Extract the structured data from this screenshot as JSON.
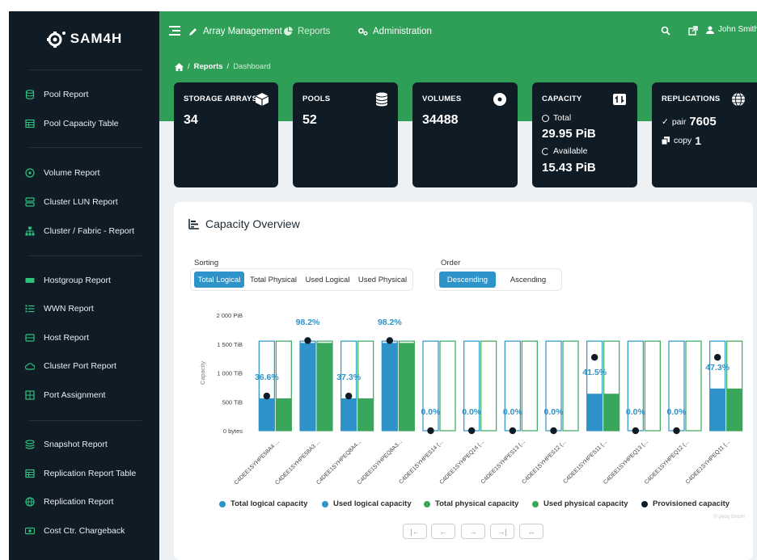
{
  "app": {
    "logo_text": "SAM4H"
  },
  "sidebar": {
    "items": [
      {
        "label": "Pool Report",
        "icon": "database-icon"
      },
      {
        "label": "Pool Capacity Table",
        "icon": "table-icon"
      },
      {
        "label": "Volume Report",
        "icon": "disc-icon"
      },
      {
        "label": "Cluster LUN Report",
        "icon": "server-icon"
      },
      {
        "label": "Cluster / Fabric - Report",
        "icon": "sitemap-icon"
      },
      {
        "label": "Hostgroup Report",
        "icon": "hdd-icon"
      },
      {
        "label": "WWN Report",
        "icon": "list-icon"
      },
      {
        "label": "Host Report",
        "icon": "host-icon"
      },
      {
        "label": "Cluster Port Report",
        "icon": "cloud-icon"
      },
      {
        "label": "Port Assignment",
        "icon": "grid-icon"
      },
      {
        "label": "Snapshot Report",
        "icon": "layers-icon"
      },
      {
        "label": "Replication Report Table",
        "icon": "table-icon"
      },
      {
        "label": "Replication Report",
        "icon": "globe-icon"
      },
      {
        "label": "Cost Ctr. Chargeback",
        "icon": "money-icon"
      }
    ]
  },
  "header": {
    "nav": [
      {
        "label": "Array Management",
        "icon": "pencil-icon"
      },
      {
        "label": "Reports",
        "icon": "pie-chart-icon"
      },
      {
        "label": "Administration",
        "icon": "cogs-icon"
      }
    ],
    "user": "John Smith"
  },
  "breadcrumb": {
    "items": [
      "Reports",
      "Dashboard"
    ]
  },
  "cards": {
    "storage_arrays": {
      "title": "STORAGE ARRAYS",
      "value": "34",
      "icon": "cube-icon"
    },
    "pools": {
      "title": "POOLS",
      "value": "52",
      "icon": "database-icon"
    },
    "volumes": {
      "title": "VOLUMES",
      "value": "34488",
      "icon": "disc-icon"
    },
    "capacity": {
      "title": "CAPACITY",
      "total_label": "Total",
      "total_value": "29.95 PiB",
      "available_label": "Available",
      "available_value": "15.43 PiB",
      "icon": "transfer-icon"
    },
    "replications": {
      "title": "REPLICATIONS",
      "pair_label": "pair",
      "pair_value": "7605",
      "copy_label": "copy",
      "copy_value": "1",
      "icon": "globe-icon"
    }
  },
  "panel": {
    "title": "Capacity Overview",
    "sorting": {
      "label": "Sorting",
      "options": [
        "Total Logical",
        "Total Physical",
        "Used Logical",
        "Used Physical"
      ],
      "selected": "Total Logical"
    },
    "order": {
      "label": "Order",
      "options": [
        "Descending",
        "Ascending"
      ],
      "selected": "Descending"
    },
    "legend": [
      {
        "label": "Total logical capacity",
        "color": "#2d93c8"
      },
      {
        "label": "Used logical capacity",
        "color": "#2d93c8"
      },
      {
        "label": "Total physical capacity",
        "color": "#3aa65c"
      },
      {
        "label": "Used physical capacity",
        "color": "#3aa65c"
      },
      {
        "label": "Provisioned capacity",
        "color": "#0f1b25"
      }
    ],
    "pager": [
      "|←",
      "←",
      "→",
      "→|",
      "↔"
    ],
    "credit": "© peoq GmbH"
  },
  "colors": {
    "sidebar_bg": "#0f1b25",
    "header_bg": "#2f9e56",
    "logical": "#2d93c8",
    "physical": "#3aa65c",
    "provisioned": "#0f1b25"
  },
  "chart_data": {
    "type": "bar",
    "ylabel": "Capacity",
    "ytick_labels": [
      "0 bytes",
      "500 TiB",
      "1 000 TiB",
      "1 500 TiB",
      "2 000 PiB"
    ],
    "ytick_values": [
      0,
      500,
      1000,
      1500,
      2000
    ],
    "ylim": [
      0,
      2000
    ],
    "categories": [
      "C4DEE1SYHPE58A4 ...",
      "C4DEE1SYHPE58A3 ...",
      "C4DEE1SYHPEQ8A4...",
      "C4DEE1SYHPEQ8A3...",
      "C4DEE1SYHPES14 (...",
      "C4DEE1SYHPEQ14 (...",
      "C4DEE1SYHPES13 (...",
      "C4DEE1SYHPES12 (...",
      "C4DEE1SYHPES11 (...",
      "C4DEE1SYHPEQ13 (...",
      "C4DEE1SYHPEQ12 (...",
      "C4DEE1SYHPEQ11 (..."
    ],
    "series": [
      {
        "name": "Total logical capacity",
        "values": [
          1550,
          1550,
          1550,
          1550,
          1550,
          1550,
          1550,
          1550,
          1550,
          1550,
          1550,
          1550
        ]
      },
      {
        "name": "Used logical capacity",
        "values": [
          560,
          1520,
          560,
          1520,
          0,
          0,
          0,
          0,
          640,
          0,
          0,
          730
        ]
      },
      {
        "name": "Total physical capacity",
        "values": [
          1550,
          1550,
          1550,
          1550,
          1550,
          1550,
          1550,
          1550,
          1550,
          1550,
          1550,
          1550
        ]
      },
      {
        "name": "Used physical capacity",
        "values": [
          560,
          1520,
          560,
          1520,
          0,
          0,
          0,
          0,
          640,
          0,
          0,
          730
        ]
      },
      {
        "name": "Provisioned capacity",
        "values": [
          600,
          1560,
          600,
          1560,
          0,
          0,
          0,
          0,
          1270,
          0,
          0,
          1270
        ]
      }
    ],
    "data_labels": [
      "36.6%",
      "98.2%",
      "37.3%",
      "98.2%",
      "0.0%",
      "0.0%",
      "0.0%",
      "0.0%",
      "41.5%",
      "0.0%",
      "0.0%",
      "47.3%"
    ],
    "label_above": [
      false,
      true,
      false,
      true,
      false,
      false,
      false,
      false,
      false,
      false,
      false,
      false
    ],
    "grid": false,
    "legend_position": "bottom"
  }
}
